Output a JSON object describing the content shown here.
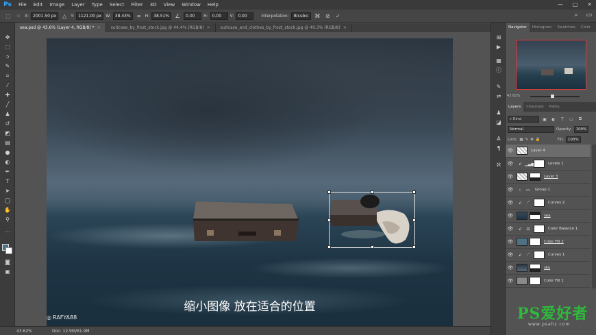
{
  "app": {
    "logo": "Ps"
  },
  "menu": [
    "File",
    "Edit",
    "Image",
    "Layer",
    "Type",
    "Select",
    "Filter",
    "3D",
    "View",
    "Window",
    "Help"
  ],
  "window_controls": [
    "—",
    "□",
    "✕"
  ],
  "options_bar": {
    "x_label": "X:",
    "x_value": "2001.50 px",
    "y_label": "Y:",
    "y_value": "1121.00 px",
    "w_label": "W:",
    "w_value": "38.43%",
    "h_label": "H:",
    "h_value": "38.51%",
    "angle_value": "0.00",
    "h_skew_label": "H:",
    "h_skew_value": "0.00",
    "v_skew_label": "V:",
    "v_skew_value": "0.00",
    "interpolation_label": "Interpolation:",
    "interpolation_value": "Bicubic"
  },
  "tabs": [
    {
      "label": "sea.psd @ 43.6% (Layer 4, RGB/8) *",
      "active": true
    },
    {
      "label": "suitcase_by_frozt_stock.jpg @ 44.4% (RGB/8)",
      "active": false
    },
    {
      "label": "suitcase_and_clothes_by_frozt_stock.jpg @ 40.3% (RGB/8)",
      "active": false
    }
  ],
  "canvas": {
    "caption": "缩小图像  放在适合的位置",
    "watermark_left": "RAFYA88"
  },
  "status": {
    "zoom": "43.62%",
    "doc": "Doc: 12.9M/61.9M"
  },
  "navigator": {
    "tabs": [
      "Navigator",
      "Histogram",
      "Swatches",
      "Color"
    ],
    "zoom": "43.62%"
  },
  "layers_panel": {
    "tabs": [
      "Layers",
      "Channels",
      "Paths"
    ],
    "kind_label": "Kind",
    "blend_mode": "Normal",
    "opacity_label": "Opacity:",
    "opacity_value": "100%",
    "lock_label": "Lock:",
    "fill_label": "Fill:",
    "fill_value": "100%",
    "layers": [
      {
        "name": "Layer 4",
        "selected": true,
        "underline": false
      },
      {
        "name": "Levels 1",
        "selected": false,
        "underline": false
      },
      {
        "name": "Layer 3",
        "selected": false,
        "underline": true
      },
      {
        "name": "Group 1",
        "selected": false,
        "underline": false
      },
      {
        "name": "Curves 2",
        "selected": false,
        "underline": false
      },
      {
        "name": "sea",
        "selected": false,
        "underline": true
      },
      {
        "name": "Color Balance 1",
        "selected": false,
        "underline": false
      },
      {
        "name": "Color Fill 2",
        "selected": false,
        "underline": true
      },
      {
        "name": "Curves 1",
        "selected": false,
        "underline": false
      },
      {
        "name": "sky",
        "selected": false,
        "underline": true
      },
      {
        "name": "Color Fill 1",
        "selected": false,
        "underline": false
      }
    ]
  },
  "site_watermark": {
    "title": "PS爱好者",
    "url": "www.psahz.com"
  },
  "colors": {
    "accent": "#31a8ff",
    "selection": "#6c6c6c",
    "nav_view": "#e03a3a",
    "watermark": "#2fb83c"
  }
}
